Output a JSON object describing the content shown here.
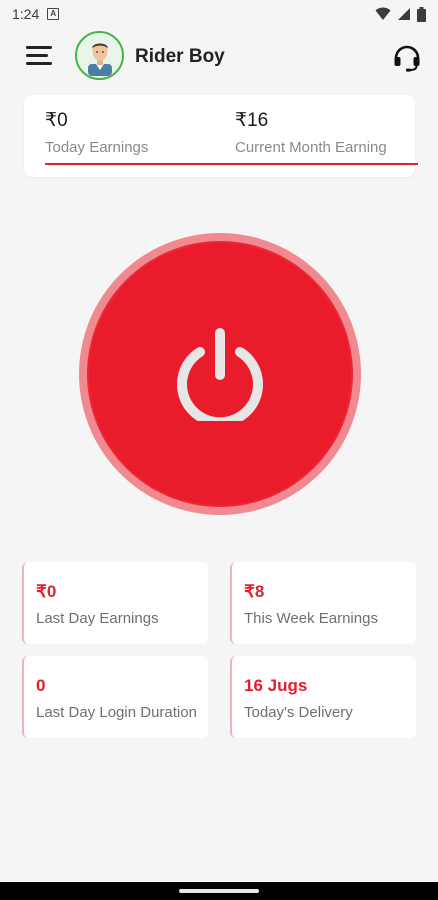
{
  "status_bar": {
    "time": "1:24",
    "notification_icon": "a-notification-icon",
    "icons": [
      "wifi-icon",
      "signal-icon",
      "battery-icon"
    ]
  },
  "header": {
    "user_name": "Rider Boy",
    "avatar_icon": "rider-avatar-icon",
    "menu_icon": "hamburger-menu-icon",
    "support_icon": "headset-icon"
  },
  "earnings_summary": {
    "today": {
      "value": "₹0",
      "label": "Today Earnings"
    },
    "month": {
      "value": "₹16",
      "label": "Current Month Earning"
    }
  },
  "power_button": {
    "icon": "power-icon",
    "color_outer": "#f08a90",
    "color_inner": "#ea1c2b"
  },
  "stats": [
    {
      "value": "₹0",
      "label": "Last Day Earnings"
    },
    {
      "value": "₹8",
      "label": "This Week Earnings"
    },
    {
      "value": "0",
      "label": "Last Day Login Duration"
    },
    {
      "value": "16 Jugs",
      "label": "Today's Delivery"
    }
  ],
  "colors": {
    "accent": "#e0202c",
    "background": "#f5f5f5",
    "avatar_ring": "#4caf50"
  }
}
